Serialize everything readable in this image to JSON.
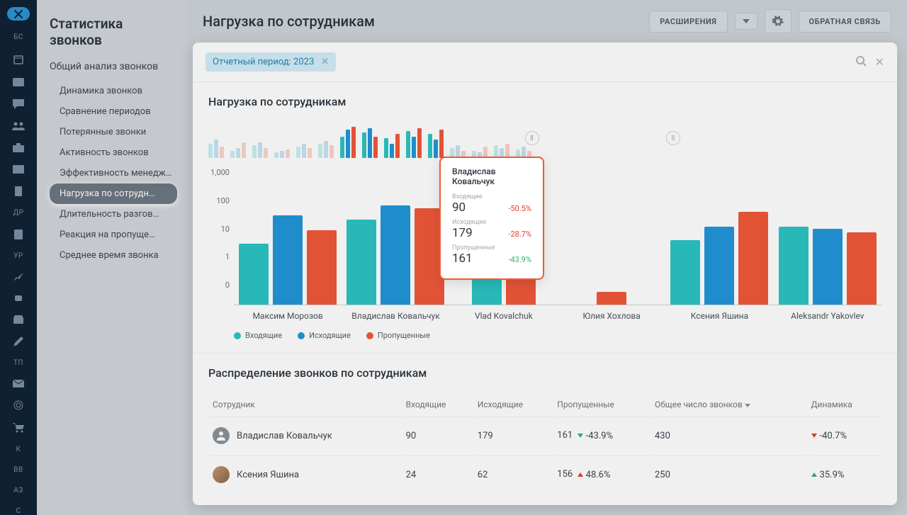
{
  "iconbar": {
    "items": [
      "БС",
      "",
      "",
      "",
      "",
      "",
      "",
      "",
      "ДР",
      "",
      "УР",
      "",
      "",
      "",
      "",
      "ТП",
      "",
      "",
      "",
      "К",
      "ВВ",
      "АЗ",
      "С"
    ]
  },
  "sidebar": {
    "title": "Статистика звонков",
    "section": "Общий анализ звонков",
    "items": [
      {
        "label": "Динамика звонков"
      },
      {
        "label": "Сравнение периодов"
      },
      {
        "label": "Потерянные звонки"
      },
      {
        "label": "Активность звонков"
      },
      {
        "label": "Эффективность менедж…"
      },
      {
        "label": "Нагрузка по сотрудн…",
        "active": true
      },
      {
        "label": "Длительность разгов…"
      },
      {
        "label": "Реакция на пропуще…"
      },
      {
        "label": "Среднее время звонка"
      }
    ]
  },
  "topbar": {
    "title": "Нагрузка по сотрудникам",
    "ext": "РАСШИРЕНИЯ",
    "feedback": "ОБРАТНАЯ СВЯЗЬ"
  },
  "filter": {
    "chip": "Отчетный период: 2023"
  },
  "card1": {
    "title": "Нагрузка по сотрудникам",
    "yTicks": [
      "1,000",
      "100",
      "10",
      "1",
      "0"
    ],
    "xLabels": [
      "Максим Морозов",
      "Владислав Ковальчук",
      "Vlad Kovalchuk",
      "Юлия Хохлова",
      "Ксения Яшина",
      "Aleksandr Yakovlev"
    ],
    "legend": {
      "in": "Входящие",
      "out": "Исходящие",
      "miss": "Пропущенные"
    }
  },
  "tooltip": {
    "name": "Владислав Ковальчук",
    "rows": [
      {
        "label": "Входящие",
        "value": "90",
        "pct": "-50.5%",
        "color": "#e63f2e"
      },
      {
        "label": "Исходящие",
        "value": "179",
        "pct": "-28.7%",
        "color": "#e63f2e"
      },
      {
        "label": "Пропущенные",
        "value": "161",
        "pct": "-43.9%",
        "color": "#2fb36c"
      }
    ]
  },
  "table": {
    "title": "Распределение звонков по сотрудникам",
    "headers": {
      "emp": "Сотрудник",
      "in": "Входящие",
      "out": "Исходящие",
      "miss": "Пропущенные",
      "total": "Общее число звонков",
      "dyn": "Динамика"
    },
    "rows": [
      {
        "name": "Владислав Ковальчук",
        "in": "90",
        "out": "179",
        "miss": "161",
        "missDelta": "-43.9%",
        "missDir": "dn",
        "total": "430",
        "dyn": "-40.7%",
        "dynDir": "dnr"
      },
      {
        "name": "Ксения Яшина",
        "in": "24",
        "out": "62",
        "miss": "156",
        "missDelta": "48.6%",
        "missDir": "up",
        "total": "250",
        "dyn": "35.9%",
        "dynDir": "upg"
      }
    ]
  },
  "chart_data": {
    "type": "bar",
    "title": "Нагрузка по сотрудникам",
    "ylabel": "",
    "ylim": [
      0,
      1000
    ],
    "yscale": "log",
    "categories": [
      "Максим Морозов",
      "Владислав Ковальчук",
      "Vlad Kovalchuk",
      "Юлия Хохлова",
      "Ксения Яшина",
      "Aleksandr Yakovlev"
    ],
    "series": [
      {
        "name": "Входящие",
        "color": "#2bc4c4",
        "values": [
          25,
          90,
          40,
          0,
          30,
          60
        ]
      },
      {
        "name": "Исходящие",
        "color": "#2196d8",
        "values": [
          110,
          179,
          0,
          0,
          60,
          55
        ]
      },
      {
        "name": "Пропущенные",
        "color": "#f1593a",
        "values": [
          50,
          161,
          20,
          1,
          130,
          45
        ]
      }
    ]
  }
}
